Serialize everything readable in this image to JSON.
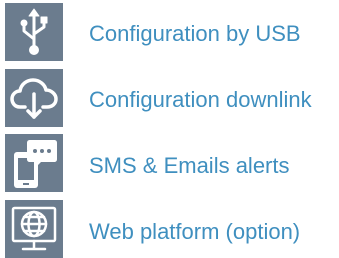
{
  "features": {
    "items": [
      {
        "icon": "usb-icon",
        "label": "Configuration by USB"
      },
      {
        "icon": "cloud-download-icon",
        "label": "Configuration downlink"
      },
      {
        "icon": "phone-message-icon",
        "label": "SMS & Emails alerts"
      },
      {
        "icon": "web-globe-monitor-icon",
        "label": "Web platform (option)"
      }
    ]
  },
  "colors": {
    "icon_tile": "#6b7c8e",
    "icon_glyph": "#ffffff",
    "label_text": "#3f8fbf"
  }
}
